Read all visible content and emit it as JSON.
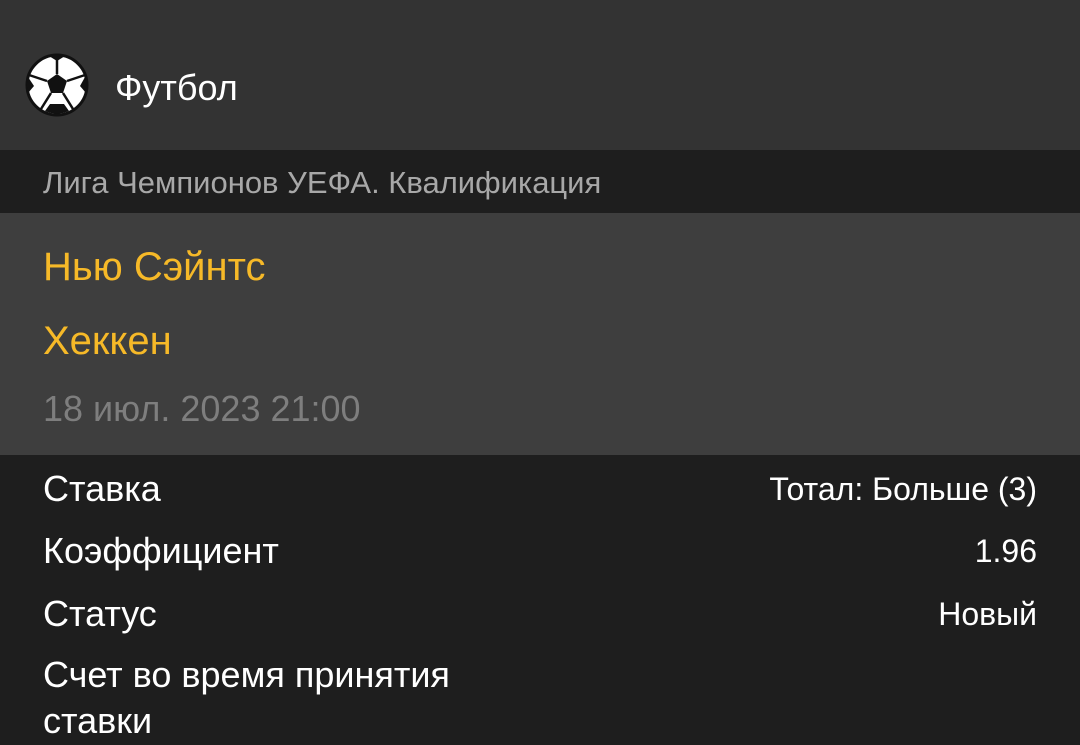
{
  "header": {
    "sport_icon": "soccer-ball-icon",
    "title": "Футбол"
  },
  "league": {
    "name": "Лига Чемпионов УЕФА. Квалификация"
  },
  "match": {
    "home_team": "Нью Сэйнтс",
    "away_team": "Хеккен",
    "datetime": "18 июл. 2023 21:00"
  },
  "bet_details": {
    "bet_label": "Ставка",
    "bet_value": "Тотал: Больше (3)",
    "odds_label": "Коэффициент",
    "odds_value": "1.96",
    "status_label": "Статус",
    "status_value": "Новый",
    "score_label": "Счет во время принятия ставки"
  },
  "colors": {
    "header_bg": "#333333",
    "page_bg": "#1e1e1e",
    "match_panel_bg": "#3e3e3e",
    "team_accent": "#f6b928"
  }
}
